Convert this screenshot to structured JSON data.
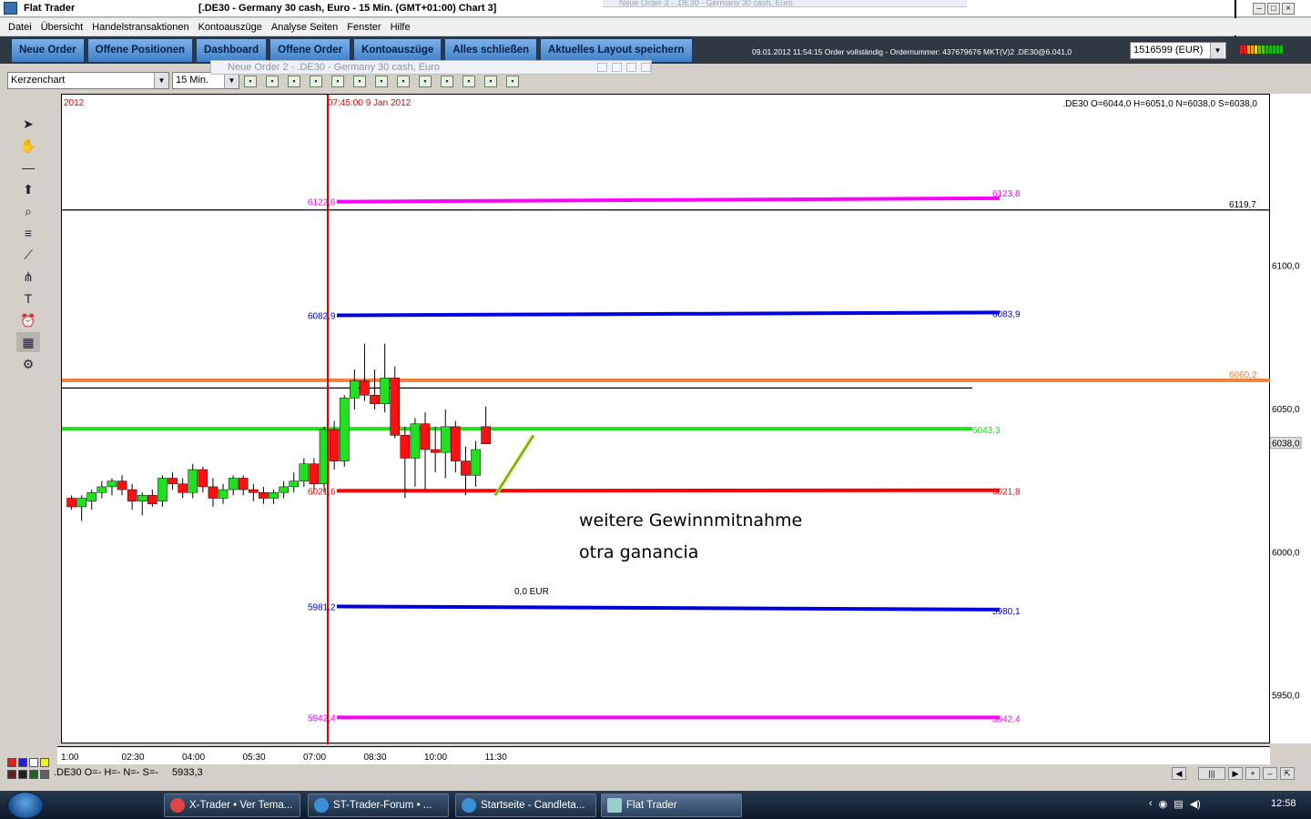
{
  "window": {
    "app_title": "Flat Trader",
    "chart_title": "[.DE30 - Germany 30 cash, Euro - 15 Min. (GMT+01:00)   Chart 3]",
    "ghost_title": "Neue Order 3 - .DE30 - Germany 30 cash, Euro"
  },
  "menu": [
    "Datei",
    "Übersicht",
    "Handelstransaktionen",
    "Kontoauszüge",
    "Analyse Seiten",
    "Fenster",
    "Hilfe"
  ],
  "toolbar": {
    "buttons": [
      "Neue Order",
      "Offene Positionen",
      "Dashboard",
      "Offene Order",
      "Kontoauszüge",
      "Alles schließen",
      "Aktuelles Layout speichern"
    ],
    "status": "09.01.2012 11:54:15 Order vollständig - Ordernummer: 437679676 MKT(V)2 .DE30@6.041,0",
    "account": "1516599 (EUR)",
    "signal_colors": [
      "#e02020",
      "#e02020",
      "#f0a020",
      "#f0a020",
      "#f0d020",
      "#60c020",
      "#60c020",
      "#20b020",
      "#20b020",
      "#20b020",
      "#20b020",
      "#20b020"
    ]
  },
  "chart_toolbar": {
    "chart_type": "Kerzenchart",
    "interval": "15 Min.",
    "icons": [
      "compare-icon",
      "indicator-icon",
      "filter-icon",
      "chart-icon",
      "check-icon",
      "check-icon",
      "doc-icon",
      "doc-icon",
      "doc-icon",
      "refresh-icon",
      "export-icon",
      "export-icon",
      "export-icon"
    ]
  },
  "order_window": {
    "title": "Neue Order 2 - .DE30 - Germany 30 cash, Euro"
  },
  "left_tools": [
    "pointer-icon",
    "hand-icon",
    "line-icon",
    "arrow-up-icon",
    "zoom-icon",
    "fib-icon",
    "trendline-icon",
    "pitchfork-icon",
    "text-icon",
    "alarm-icon",
    "calculator-icon",
    "settings-icon"
  ],
  "chart_header": {
    "year": "2012",
    "marker_time": "07:45:00 9 Jan 2012",
    "ohlc": ".DE30 O=6044,0 H=6051,0 N=6038,0 S=6038,0"
  },
  "annotations": {
    "line1": "weitere Gewinnmitnahme",
    "line2": "otra ganancia",
    "pl": "0,0 EUR"
  },
  "bottom": {
    "info": ".DE30 O=- H=- N=- S=-",
    "value": "5933,3",
    "swatch_colors": [
      "#e02020",
      "#2020e0",
      "#ffffff",
      "#f0f020",
      "#602020",
      "#202020",
      "#206020",
      "#606060"
    ]
  },
  "taskbar": {
    "items": [
      "X-Trader • Ver Tema...",
      "ST-Trader-Forum • ...",
      "Startseite - Candleta...",
      "Flat Trader"
    ],
    "clock": "12:58"
  },
  "chart_data": {
    "type": "candlestick",
    "symbol": ".DE30",
    "interval": "15 Min.",
    "ylim": [
      5933,
      6160
    ],
    "x_ticks": [
      "1:00",
      "02:30",
      "04:00",
      "05:30",
      "07:00",
      "08:30",
      "10:00",
      "11:30"
    ],
    "y_ticks": [
      {
        "value": 6100,
        "label": "6100,0"
      },
      {
        "value": 6050,
        "label": "6050,0"
      },
      {
        "value": 6000,
        "label": "6000,0"
      },
      {
        "value": 5950,
        "label": "5950,0"
      }
    ],
    "current_price": {
      "value": 6038,
      "label": "6038,0"
    },
    "levels": [
      {
        "label_left": "6122,6",
        "label_right": "6123,8",
        "v0": 6122.6,
        "v1": 6123.8,
        "color": "#ff00ff"
      },
      {
        "label_left": "",
        "label_right": "6119,7",
        "v0": 6119.7,
        "v1": 6119.7,
        "color": "#000000"
      },
      {
        "label_left": "6082,9",
        "label_right": "6083,9",
        "v0": 6082.9,
        "v1": 6083.9,
        "color": "#0000e0"
      },
      {
        "label_left": "",
        "label_right": "6060,2",
        "v0": 6060.2,
        "v1": 6060.2,
        "color": "#f08040"
      },
      {
        "label_left": "",
        "label_right": "",
        "v0": 6057.5,
        "v1": 6057.5,
        "color": "#000000"
      },
      {
        "label_left": "",
        "label_right": "6043,3",
        "v0": 6043.3,
        "v1": 6043.3,
        "color": "#20e020"
      },
      {
        "label_left": "6021,6",
        "label_right": "6021,8",
        "v0": 6021.6,
        "v1": 6021.8,
        "color": "#ff0000"
      },
      {
        "label_left": "5981,2",
        "label_right": "5980,1",
        "v0": 5981.2,
        "v1": 5980.1,
        "color": "#0000e0"
      },
      {
        "label_left": "5942,4",
        "label_right": "5942,4",
        "v0": 5942.4,
        "v1": 5942.4,
        "color": "#ff00ff"
      }
    ],
    "candles": [
      {
        "o": 6019,
        "h": 6020,
        "l": 6015,
        "c": 6016
      },
      {
        "o": 6016,
        "h": 6020,
        "l": 6011,
        "c": 6019
      },
      {
        "o": 6018,
        "h": 6022,
        "l": 6015,
        "c": 6021
      },
      {
        "o": 6021,
        "h": 6025,
        "l": 6019,
        "c": 6023
      },
      {
        "o": 6023,
        "h": 6026,
        "l": 6020,
        "c": 6025
      },
      {
        "o": 6025,
        "h": 6027,
        "l": 6020,
        "c": 6022
      },
      {
        "o": 6022,
        "h": 6024,
        "l": 6015,
        "c": 6018
      },
      {
        "o": 6018,
        "h": 6021,
        "l": 6013,
        "c": 6020
      },
      {
        "o": 6020,
        "h": 6022,
        "l": 6016,
        "c": 6017
      },
      {
        "o": 6018,
        "h": 6027,
        "l": 6016,
        "c": 6026
      },
      {
        "o": 6026,
        "h": 6028,
        "l": 6022,
        "c": 6024
      },
      {
        "o": 6024,
        "h": 6026,
        "l": 6019,
        "c": 6021
      },
      {
        "o": 6021,
        "h": 6031,
        "l": 6019,
        "c": 6029
      },
      {
        "o": 6029,
        "h": 6030,
        "l": 6021,
        "c": 6023
      },
      {
        "o": 6023,
        "h": 6026,
        "l": 6016,
        "c": 6019
      },
      {
        "o": 6019,
        "h": 6024,
        "l": 6017,
        "c": 6022
      },
      {
        "o": 6022,
        "h": 6027,
        "l": 6020,
        "c": 6026
      },
      {
        "o": 6026,
        "h": 6027,
        "l": 6020,
        "c": 6022
      },
      {
        "o": 6022,
        "h": 6024,
        "l": 6018,
        "c": 6021
      },
      {
        "o": 6021,
        "h": 6023,
        "l": 6017,
        "c": 6019
      },
      {
        "o": 6019,
        "h": 6022,
        "l": 6017,
        "c": 6021
      },
      {
        "o": 6021,
        "h": 6025,
        "l": 6019,
        "c": 6023
      },
      {
        "o": 6023,
        "h": 6028,
        "l": 6021,
        "c": 6025
      },
      {
        "o": 6025,
        "h": 6033,
        "l": 6023,
        "c": 6031
      },
      {
        "o": 6031,
        "h": 6033,
        "l": 6022,
        "c": 6024
      },
      {
        "o": 6024,
        "h": 6044,
        "l": 6021,
        "c": 6043
      },
      {
        "o": 6043,
        "h": 6046,
        "l": 6029,
        "c": 6032
      },
      {
        "o": 6032,
        "h": 6055,
        "l": 6030,
        "c": 6054
      },
      {
        "o": 6054,
        "h": 6064,
        "l": 6050,
        "c": 6060
      },
      {
        "o": 6060,
        "h": 6073,
        "l": 6053,
        "c": 6055
      },
      {
        "o": 6055,
        "h": 6064,
        "l": 6050,
        "c": 6052
      },
      {
        "o": 6052,
        "h": 6073,
        "l": 6049,
        "c": 6061
      },
      {
        "o": 6061,
        "h": 6065,
        "l": 6040,
        "c": 6041
      },
      {
        "o": 6041,
        "h": 6044,
        "l": 6019,
        "c": 6033
      },
      {
        "o": 6033,
        "h": 6047,
        "l": 6023,
        "c": 6045
      },
      {
        "o": 6045,
        "h": 6049,
        "l": 6022,
        "c": 6036
      },
      {
        "o": 6036,
        "h": 6044,
        "l": 6028,
        "c": 6035
      },
      {
        "o": 6035,
        "h": 6050,
        "l": 6026,
        "c": 6044
      },
      {
        "o": 6044,
        "h": 6046,
        "l": 6028,
        "c": 6032
      },
      {
        "o": 6032,
        "h": 6037,
        "l": 6020,
        "c": 6027
      },
      {
        "o": 6027,
        "h": 6039,
        "l": 6023,
        "c": 6036
      },
      {
        "o": 6044,
        "h": 6051,
        "l": 6038,
        "c": 6038
      }
    ]
  }
}
